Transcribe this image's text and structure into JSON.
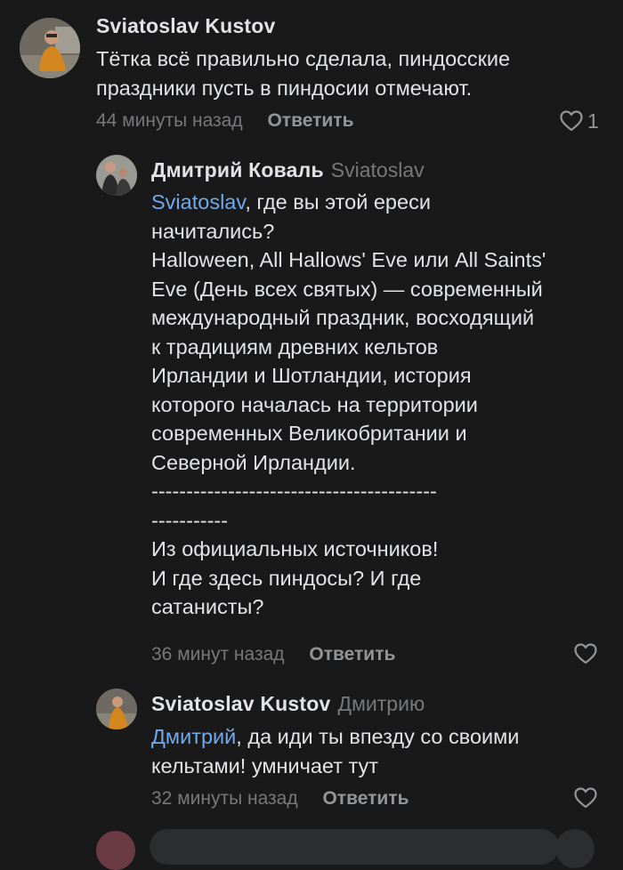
{
  "comments": [
    {
      "author": "Sviatoslav Kustov",
      "reply_to": "",
      "mention": "",
      "text": "Тётка всё правильно сделала, пиндосские\nпраздники пусть в пиндосии отмечают.",
      "time": "44 минуты назад",
      "reply_label": "Ответить",
      "likes": "1",
      "avatar_icon": "user-avatar-photo"
    },
    {
      "author": "Дмитрий Коваль",
      "reply_to": "Sviatoslav",
      "mention": "Sviatoslav",
      "text": ", где вы этой ереси\nначитались?\nHalloween, All Hallows' Eve или All Saints'\nEve (День всех святых) — современный\nмеждународный праздник, восходящий\nк традициям древних кельтов\nИрландии и Шотландии, история\nкоторого началась на территории\nсовременных Великобритании и\nСеверной Ирландии.\n-----------------------------------------\n-----------\nИз официальных источников!\nИ где здесь пиндосы? И где\nсатанисты?",
      "time": "36 минут назад",
      "reply_label": "Ответить",
      "likes": "",
      "avatar_icon": "user-avatar-photo"
    },
    {
      "author": "Sviatoslav Kustov",
      "reply_to": "Дмитрию",
      "mention": "Дмитрий",
      "text": ", да иди ты впезду со своими\nкельтами! умничает тут",
      "time": "32 минуты назад",
      "reply_label": "Ответить",
      "likes": "",
      "avatar_icon": "user-avatar-photo"
    }
  ],
  "colors": {
    "background": "#19191a",
    "text": "#e1e3e6",
    "secondary": "#76787a",
    "mention": "#71aaeb"
  }
}
